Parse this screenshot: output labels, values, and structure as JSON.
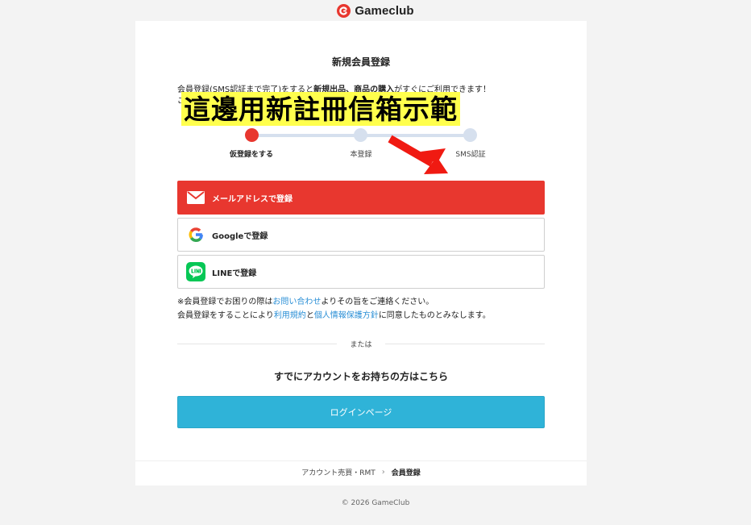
{
  "header": {
    "brand": "Gameclub",
    "logo_icon": "gameclub-logo-icon"
  },
  "page": {
    "title": "新規会員登録",
    "intro_prefix": "会員登録(SMS認証まで完了)をすると",
    "intro_bold": "新規出品、商品の購入",
    "intro_suffix": "がすぐにご利用できます！",
    "intro_second_line": "ご"
  },
  "overlay": {
    "text": "這邊用新註冊信箱示範"
  },
  "steps": [
    {
      "label": "仮登録をする",
      "active": true
    },
    {
      "label": "本登録",
      "active": false
    },
    {
      "label": "SMS認証",
      "active": false
    }
  ],
  "buttons": {
    "mail": "メールアドレスで登録",
    "google": "Googleで登録",
    "line": "LINEで登録",
    "login": "ログインページ"
  },
  "notes": {
    "line1_prefix": "※会員登録でお困りの際は",
    "line1_link": "お問い合わせ",
    "line1_suffix": "よりその旨をご連絡ください。",
    "line2_prefix": "会員登録をすることにより",
    "line2_link1": "利用規約",
    "line2_mid": "と",
    "line2_link2": "個人情報保護方針",
    "line2_suffix": "に同意したものとみなします。"
  },
  "divider": {
    "label": "または"
  },
  "existing": {
    "text": "すでにアカウントをお持ちの方はこちら"
  },
  "breadcrumb": {
    "parent": "アカウント売買・RMT",
    "current": "会員登録"
  },
  "footer": {
    "copyright": "© 2026 GameClub"
  },
  "colors": {
    "brand_red": "#e8372f",
    "login_blue": "#2fb3d8",
    "link_blue": "#2a8fd6",
    "highlight_yellow": "#ffff4d"
  }
}
